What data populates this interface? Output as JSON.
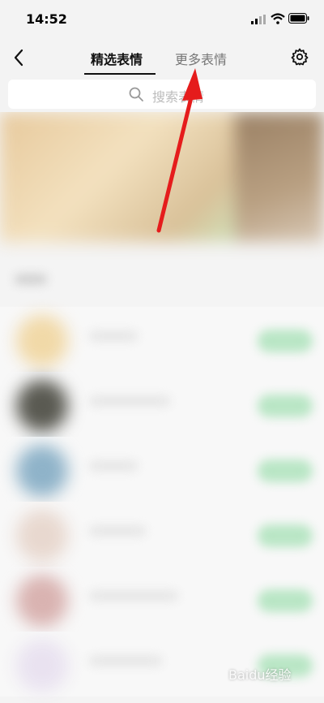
{
  "status_bar": {
    "time": "14:52",
    "icons": [
      "signal-icon",
      "wifi-icon",
      "battery-icon"
    ]
  },
  "nav": {
    "back_icon": "chevron-left-icon",
    "tabs": [
      {
        "label": "精选表情",
        "selected": true
      },
      {
        "label": "更多表情",
        "selected": false
      }
    ],
    "settings_icon": "gear-icon"
  },
  "search": {
    "placeholder": "搜索表情"
  },
  "watermark": "Baidu经验",
  "colors": {
    "background": "#f3f3f3",
    "active_tab": "#111111",
    "inactive_tab": "#777777",
    "annotation_arrow": "#e51c1c",
    "download_button": "#b9e6c5"
  }
}
